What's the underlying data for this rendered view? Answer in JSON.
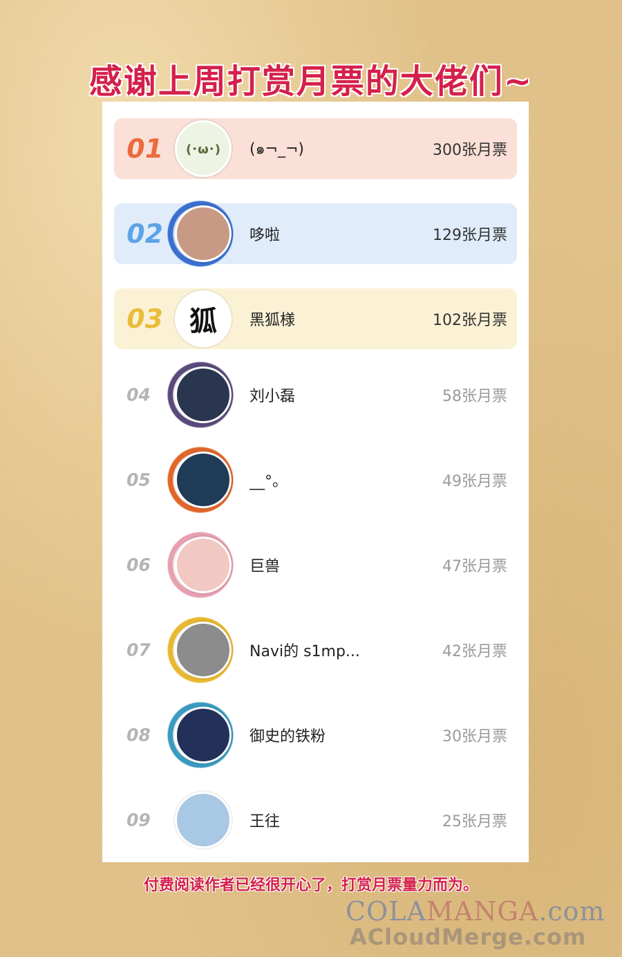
{
  "title": "感谢上周打赏月票的大佬们~",
  "ranking": [
    {
      "rank": "01",
      "name": "(๑¬_¬)",
      "votes": "300张月票",
      "avatar_icon": "sprout-cartoon-avatar",
      "avatar_text": "(･ω･)",
      "row_color": "#fae0d6",
      "rank_color": "#ec6a3c",
      "avatar_color": "#eef4e4"
    },
    {
      "rank": "02",
      "name": "哆啦",
      "votes": "129张月票",
      "avatar_icon": "portrait-avatar",
      "avatar_text": "",
      "row_color": "#e0ecfa",
      "rank_color": "#5ba4e6",
      "avatar_color": "#c89a86"
    },
    {
      "rank": "03",
      "name": "黑狐様",
      "votes": "102张月票",
      "avatar_icon": "fox-character-avatar",
      "avatar_text": "狐",
      "row_color": "#fbf2d6",
      "rank_color": "#e9bd3a",
      "avatar_color": "#ffffff"
    },
    {
      "rank": "04",
      "name": "刘小磊",
      "votes": "58张月票",
      "avatar_icon": "galaxy-avatar",
      "avatar_text": "",
      "row_color": "",
      "rank_color": "#b4b4b4",
      "avatar_color": "#2a3550"
    },
    {
      "rank": "05",
      "name": "__°。",
      "votes": "49张月票",
      "avatar_icon": "ocean-avatar",
      "avatar_text": "",
      "row_color": "",
      "rank_color": "#b4b4b4",
      "avatar_color": "#1f3b56"
    },
    {
      "rank": "06",
      "name": "巨兽",
      "votes": "47张月票",
      "avatar_icon": "anime-girl-avatar",
      "avatar_text": "",
      "row_color": "",
      "rank_color": "#b4b4b4",
      "avatar_color": "#f2c8c2"
    },
    {
      "rank": "07",
      "name": "Navi的 s1mp...",
      "votes": "42张月票",
      "avatar_icon": "cat-photo-avatar",
      "avatar_text": "",
      "row_color": "",
      "rank_color": "#b4b4b4",
      "avatar_color": "#8c8c8c"
    },
    {
      "rank": "08",
      "name": "御史的铁粉",
      "votes": "30张月票",
      "avatar_icon": "poster-avatar",
      "avatar_text": "",
      "row_color": "",
      "rank_color": "#b4b4b4",
      "avatar_color": "#23305a"
    },
    {
      "rank": "09",
      "name": "王往",
      "votes": "25张月票",
      "avatar_icon": "cartoon-cat-avatar",
      "avatar_text": "",
      "row_color": "",
      "rank_color": "#b4b4b4",
      "avatar_color": "#a9c8e4"
    }
  ],
  "footer": "付费阅读作者已经很开心了，打赏月票量力而为。",
  "watermark": {
    "line1_part1": "COLA",
    "line1_part2": "MANGA",
    "line1_part3": ".com",
    "line2": "ACloudMerge.com"
  }
}
